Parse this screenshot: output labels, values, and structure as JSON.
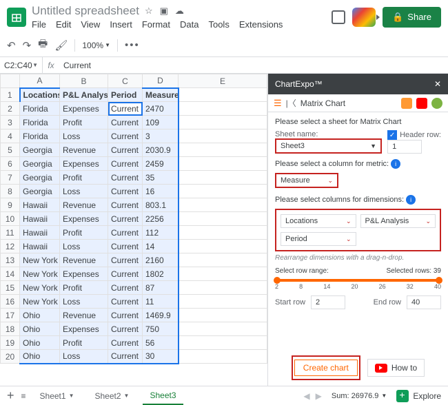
{
  "header": {
    "doc_title": "Untitled spreadsheet",
    "menus": [
      "File",
      "Edit",
      "View",
      "Insert",
      "Format",
      "Data",
      "Tools",
      "Extensions"
    ],
    "share": "Share"
  },
  "toolbar": {
    "zoom": "100%"
  },
  "fx": {
    "namebox": "C2:C40",
    "value": "Current"
  },
  "columns": [
    "A",
    "B",
    "C",
    "D",
    "E"
  ],
  "grid_header": [
    "Locations",
    "P&L Analysis",
    "Period",
    "Measure"
  ],
  "rows": [
    [
      "Florida",
      "Expenses",
      "Current",
      "2470"
    ],
    [
      "Florida",
      "Profit",
      "Current",
      "109"
    ],
    [
      "Florida",
      "Loss",
      "Current",
      "3"
    ],
    [
      "Georgia",
      "Revenue",
      "Current",
      "2030.9"
    ],
    [
      "Georgia",
      "Expenses",
      "Current",
      "2459"
    ],
    [
      "Georgia",
      "Profit",
      "Current",
      "35"
    ],
    [
      "Georgia",
      "Loss",
      "Current",
      "16"
    ],
    [
      "Hawaii",
      "Revenue",
      "Current",
      "803.1"
    ],
    [
      "Hawaii",
      "Expenses",
      "Current",
      "2256"
    ],
    [
      "Hawaii",
      "Profit",
      "Current",
      "112"
    ],
    [
      "Hawaii",
      "Loss",
      "Current",
      "14"
    ],
    [
      "New York",
      "Revenue",
      "Current",
      "2160"
    ],
    [
      "New York",
      "Expenses",
      "Current",
      "1802"
    ],
    [
      "New York",
      "Profit",
      "Current",
      "87"
    ],
    [
      "New York",
      "Loss",
      "Current",
      "11"
    ],
    [
      "Ohio",
      "Revenue",
      "Current",
      "1469.9"
    ],
    [
      "Ohio",
      "Expenses",
      "Current",
      "750"
    ],
    [
      "Ohio",
      "Profit",
      "Current",
      "56"
    ],
    [
      "Ohio",
      "Loss",
      "Current",
      "30"
    ]
  ],
  "panel": {
    "title": "ChartExpo™",
    "chart_type": "Matrix Chart",
    "select_sheet_text": "Please select a sheet for Matrix Chart",
    "sheet_label": "Sheet name:",
    "sheet_value": "Sheet3",
    "header_row_label": "Header row:",
    "header_row_value": "1",
    "metric_text": "Please select a column for metric:",
    "metric_value": "Measure",
    "dim_text": "Please select columns for dimensions:",
    "dim1": "Locations",
    "dim2": "P&L Analysis",
    "dim3": "Period",
    "rearrange": "Rearrange dimensions with a drag-n-drop.",
    "range_label": "Select row range:",
    "selected_rows": "Selected rows: 39",
    "ticks": [
      "2",
      "8",
      "14",
      "20",
      "26",
      "32",
      "40"
    ],
    "start_label": "Start row",
    "start_value": "2",
    "end_label": "End row",
    "end_value": "40",
    "create": "Create chart",
    "howto": "How to"
  },
  "tabs": {
    "sheets": [
      "Sheet1",
      "Sheet2",
      "Sheet3"
    ],
    "sum": "Sum: 26976.9",
    "explore": "Explore"
  }
}
